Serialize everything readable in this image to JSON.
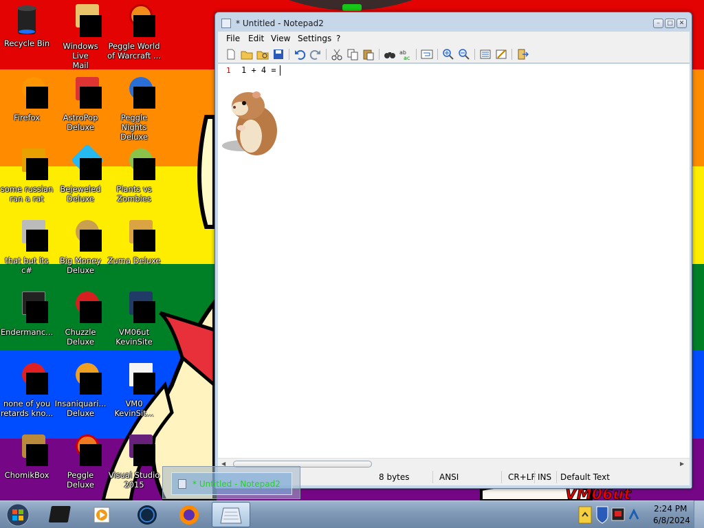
{
  "desktop": {
    "icons": [
      {
        "label": "Recycle Bin",
        "icon": "recycle-bin-icon"
      },
      {
        "label": "Windows Live\nMail",
        "icon": "windows-live-mail-icon"
      },
      {
        "label": "Peggle World\nof Warcraft ...",
        "icon": "peggle-world-of-warcraft-icon"
      },
      {
        "label": "Firefox",
        "icon": "firefox-icon"
      },
      {
        "label": "AstroPop\nDeluxe",
        "icon": "astropop-icon"
      },
      {
        "label": "Peggle Nights\nDeluxe",
        "icon": "peggle-nights-icon"
      },
      {
        "label": "some russian\nran a rat",
        "icon": "ie-icon"
      },
      {
        "label": "Bejeweled\nDeluxe",
        "icon": "bejeweled-icon"
      },
      {
        "label": "Plants vs\nZombies",
        "icon": "plants-vs-zombies-icon"
      },
      {
        "label": "that but its c#",
        "icon": "shortcut-icon"
      },
      {
        "label": "Big Money\nDeluxe",
        "icon": "big-money-icon"
      },
      {
        "label": "Zuma Deluxe",
        "icon": "zuma-icon"
      },
      {
        "label": "Endermanc...",
        "icon": "terminal-icon"
      },
      {
        "label": "Chuzzle\nDeluxe",
        "icon": "chuzzle-icon"
      },
      {
        "label": "VM06ut\nKevinSite",
        "icon": "vm-icon"
      },
      {
        "label": "none of you\nretards kno...",
        "icon": "opera-icon"
      },
      {
        "label": "Insaniquari...\nDeluxe",
        "icon": "insaniquarium-icon"
      },
      {
        "label": "VM0\nKevinSit...",
        "icon": "document-icon"
      },
      {
        "label": "ChomikBox",
        "icon": "chomikbox-icon"
      },
      {
        "label": "Peggle Deluxe",
        "icon": "peggle-deluxe-icon"
      },
      {
        "label": "Visual Studio\n2015",
        "icon": "visual-studio-icon"
      }
    ]
  },
  "notepad": {
    "title": "* Untitled - Notepad2",
    "menu": [
      "File",
      "Edit",
      "View",
      "Settings",
      "?"
    ],
    "line_number": "1",
    "content": "1 + 4 =",
    "status": {
      "size": "8 bytes",
      "encoding": "ANSI",
      "eol": "CR+LF",
      "mode": "INS",
      "scheme": "Default Text"
    },
    "caption_buttons": {
      "minimize": "–",
      "maximize": "□",
      "close": "✕"
    }
  },
  "preview": {
    "title": "* Untitled - Notepad2"
  },
  "taskbar": {
    "apps": [
      "windows-start-icon",
      "terminal-icon",
      "media-player-icon",
      "globe-icon",
      "firefox-icon",
      "notepad-icon"
    ],
    "clock": {
      "time": "2:24 PM",
      "date": "6/8/2024"
    }
  }
}
